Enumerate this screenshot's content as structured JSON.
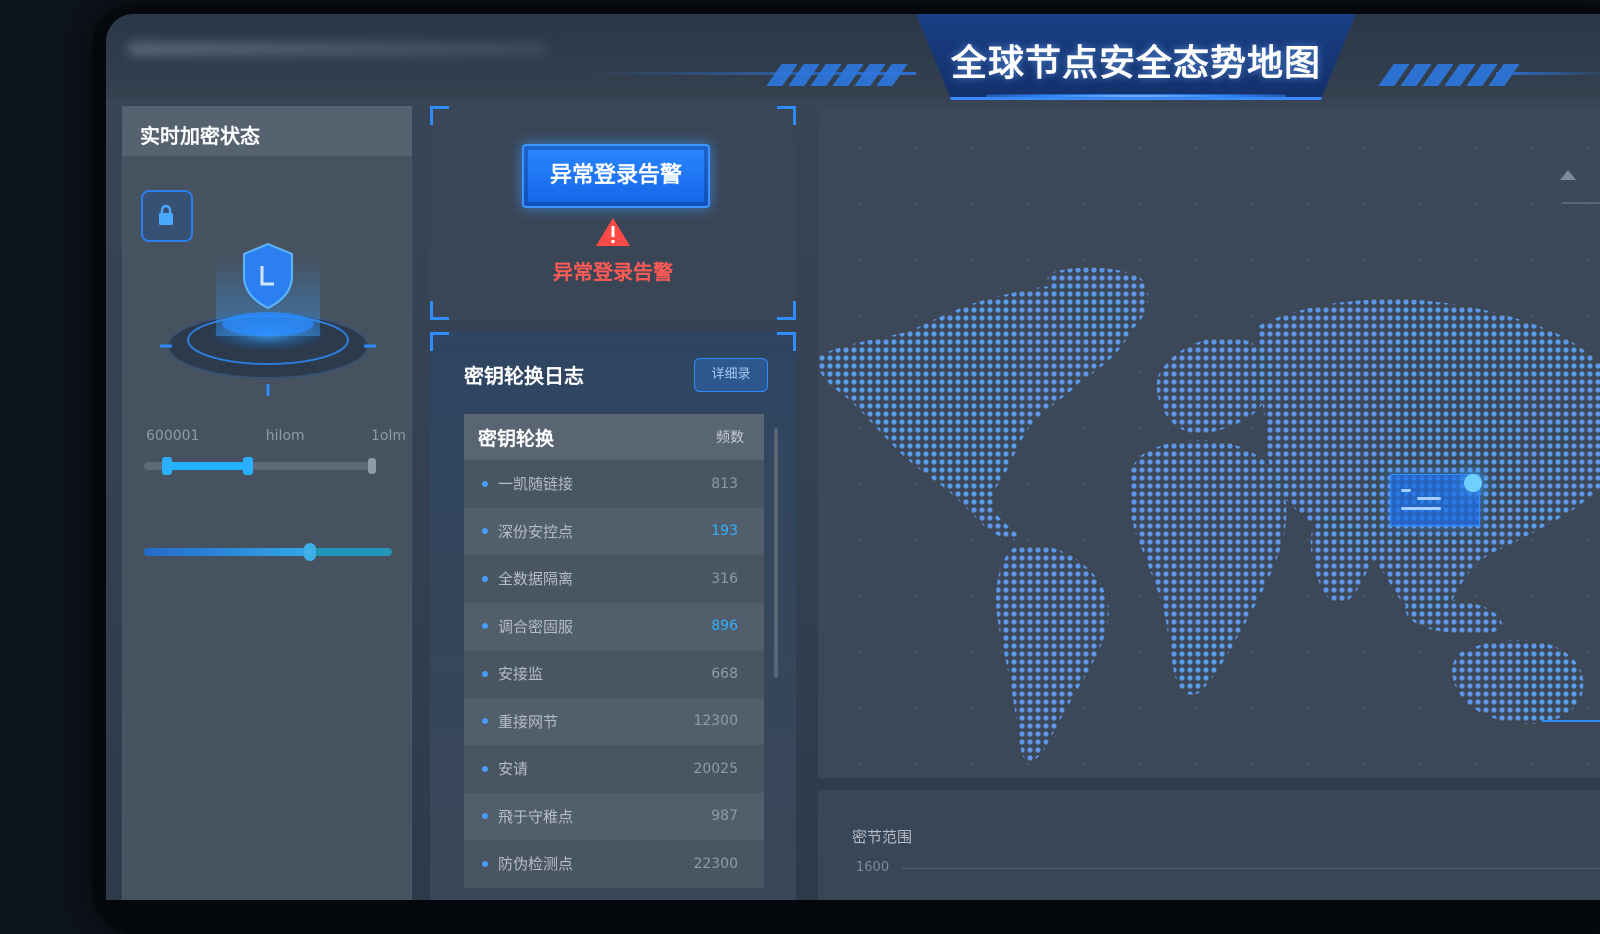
{
  "header": {
    "page_title": "全球节点安全态势地图"
  },
  "left_panel": {
    "title": "实时加密状态",
    "labels": [
      "600001",
      "hilom",
      "1olm"
    ],
    "slider1_fraction": 0.45,
    "slider2_fraction": 0.67,
    "icons": [
      "lock-icon",
      "shield-icon"
    ]
  },
  "alert_panel": {
    "button_label": "异常登录告警",
    "alert_text": "异常登录告警",
    "icon": "warning-triangle-icon"
  },
  "log_panel": {
    "title": "密钥轮换日志",
    "button_label": "详细录",
    "table": {
      "headers": [
        "密钥轮换",
        "频数"
      ],
      "rows": [
        {
          "label": "一凯随链接",
          "value": "813",
          "highlight": false
        },
        {
          "label": "深份安控点",
          "value": "193",
          "highlight": true
        },
        {
          "label": "全数据隔离",
          "value": "316",
          "highlight": false
        },
        {
          "label": "调合密固服",
          "value": "896",
          "highlight": true
        },
        {
          "label": "安接监",
          "value": "668",
          "highlight": false
        },
        {
          "label": "重接网节",
          "value": "12300",
          "highlight": false
        },
        {
          "label": "安请",
          "value": "20025",
          "highlight": false
        },
        {
          "label": "飛于守稚点",
          "value": "987",
          "highlight": false
        },
        {
          "label": "防伪检测点",
          "value": "22300",
          "highlight": false
        }
      ]
    }
  },
  "distribution_panel": {
    "title": "密节范围",
    "value": "1600"
  },
  "colors": {
    "accent": "#2f8cff",
    "alert": "#ff5a55",
    "panel": "#46525f"
  }
}
